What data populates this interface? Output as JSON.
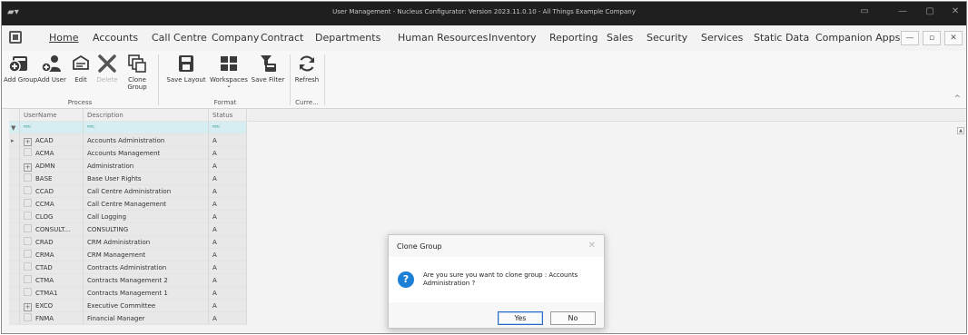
{
  "window": {
    "title": "User Management - Nucleus Configurator: Version 2023.11.0.10 - All Things Example Company",
    "app_icon": "app-icon",
    "controls": [
      "▭",
      "—",
      "▢",
      "✕"
    ]
  },
  "menu": {
    "items": [
      "Home",
      "Accounts",
      "Call Centre",
      "Company",
      "Contract",
      "Departments",
      "Human Resources",
      "Inventory",
      "Reporting",
      "Sales",
      "Security",
      "Services",
      "Static Data",
      "Companion Apps"
    ],
    "active": "Home",
    "mdi_controls": [
      "—",
      "▫",
      "✕"
    ]
  },
  "ribbon": {
    "buttons": {
      "add_group": "Add Group",
      "add_user": "Add User",
      "edit": "Edit",
      "delete": "Delete",
      "clone_group_1": "Clone",
      "clone_group_2": "Group",
      "save_layout": "Save Layout",
      "workspaces": "Workspaces",
      "workspaces_caret": "⌄",
      "save_filter": "Save Filter",
      "refresh": "Refresh"
    },
    "groups": {
      "process": "Process",
      "format": "Format",
      "current": "Curre..."
    },
    "collapse": "^"
  },
  "grid": {
    "columns": [
      "UserName",
      "Description",
      "Status"
    ],
    "filter_glyph": "ᴿᴮᶜ",
    "filter_icon": "▼",
    "current_row_marker": "▸",
    "rows": [
      {
        "code": "ACAD",
        "description": "Accounts Administration",
        "status": "A",
        "expand": "⊞"
      },
      {
        "code": "ACMA",
        "description": "Accounts Management",
        "status": "A",
        "expand": ""
      },
      {
        "code": "ADMN",
        "description": "Administration",
        "status": "A",
        "expand": "⊞"
      },
      {
        "code": "BASE",
        "description": "Base User Rights",
        "status": "A",
        "expand": ""
      },
      {
        "code": "CCAD",
        "description": "Call Centre Administration",
        "status": "A",
        "expand": ""
      },
      {
        "code": "CCMA",
        "description": "Call Centre Management",
        "status": "A",
        "expand": ""
      },
      {
        "code": "CLOG",
        "description": "Call Logging",
        "status": "A",
        "expand": ""
      },
      {
        "code": "CONSULT...",
        "description": "CONSULTING",
        "status": "A",
        "expand": ""
      },
      {
        "code": "CRAD",
        "description": "CRM Administration",
        "status": "A",
        "expand": ""
      },
      {
        "code": "CRMA",
        "description": "CRM Management",
        "status": "A",
        "expand": ""
      },
      {
        "code": "CTAD",
        "description": "Contracts Administration",
        "status": "A",
        "expand": ""
      },
      {
        "code": "CTMA",
        "description": "Contracts Management 2",
        "status": "A",
        "expand": ""
      },
      {
        "code": "CTMA1",
        "description": "Contracts Management 1",
        "status": "A",
        "expand": ""
      },
      {
        "code": "EXCO",
        "description": "Executive Committee",
        "status": "A",
        "expand": "⊞"
      },
      {
        "code": "FNMA",
        "description": "Financial Manager",
        "status": "A",
        "expand": ""
      }
    ]
  },
  "dialog": {
    "title": "Clone Group",
    "close": "✕",
    "icon": "?",
    "message": "Are you sure you want to clone group : Accounts Administration ?",
    "yes": "Yes",
    "no": "No"
  }
}
